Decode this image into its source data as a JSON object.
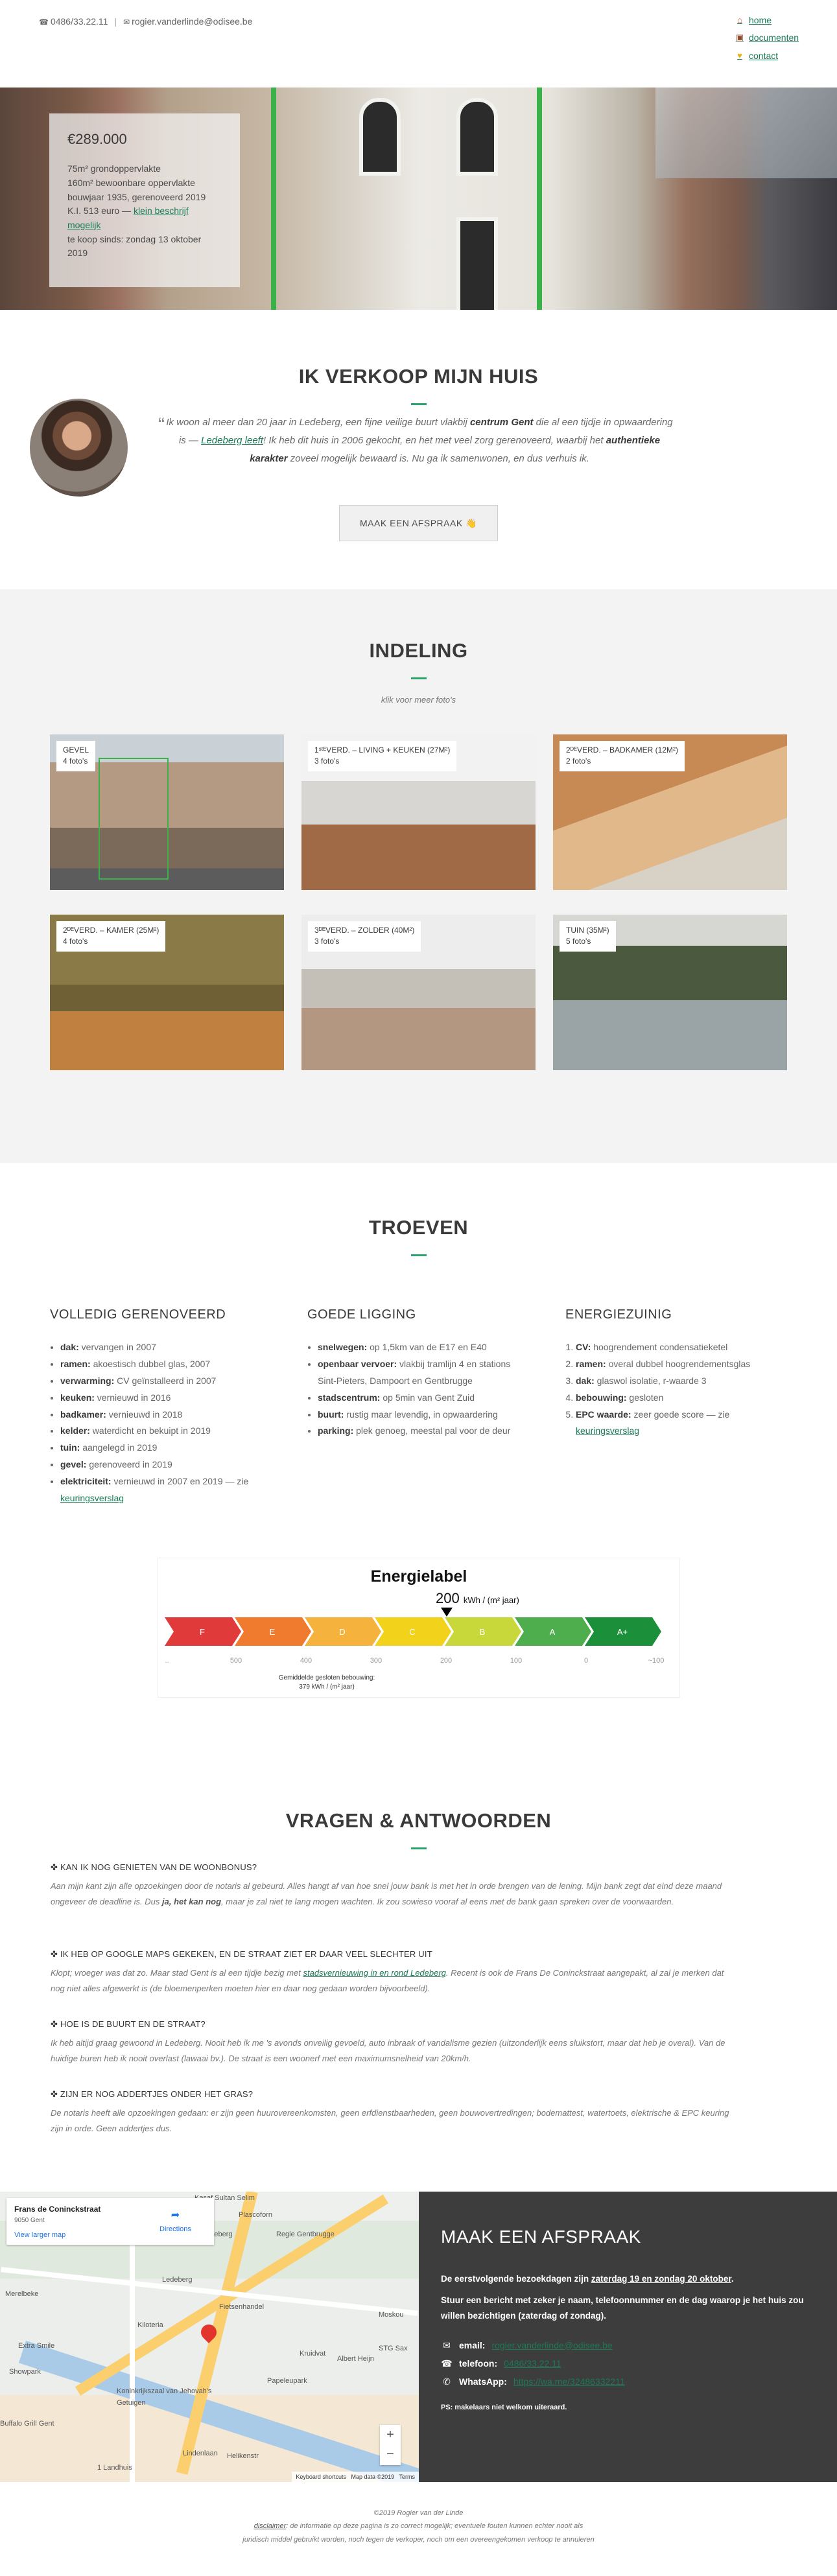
{
  "header": {
    "phone": "0486/33.22.11",
    "email": "rogier.vanderlinde@odisee.be",
    "nav": [
      {
        "label": "home",
        "icon": "home-icon"
      },
      {
        "label": "documenten",
        "icon": "briefcase-icon"
      },
      {
        "label": "contact",
        "icon": "heart-icon"
      }
    ]
  },
  "hero": {
    "price": "€289.000",
    "lines": [
      "75m² grondoppervlakte",
      "160m² bewoonbare oppervlakte",
      "bouwjaar 1935, gerenoveerd 2019",
      "K.I. 513 euro —",
      "te koop sinds: zondag 13 oktober 2019"
    ],
    "ki_link": "klein beschrijf mogelijk"
  },
  "intro": {
    "title": "IK VERKOOP MIJN HUIS",
    "quote_a": "Ik woon al meer dan 20 jaar in Ledeberg, een fijne veilige buurt vlakbij ",
    "quote_b": "centrum Gent",
    "quote_c": " die al een tijdje in opwaardering is — ",
    "quote_link": "Ledeberg leeft",
    "quote_d": "! Ik heb dit huis in 2006 gekocht, en het met veel zorg gerenoveerd, waarbij het ",
    "quote_e": "authentieke karakter",
    "quote_f": " zoveel mogelijk bewaard is. Nu ga ik samenwonen, en dus verhuis ik.",
    "button": "MAAK EEN AFSPRAAK 👋"
  },
  "indeling": {
    "title": "INDELING",
    "hint": "klik voor meer foto's",
    "tiles": [
      {
        "name": "GEVEL",
        "photos": "4 foto's"
      },
      {
        "name": "1ˢᵗᴱVERD. – LIVING + KEUKEN (27M²)",
        "photos": "3 foto's"
      },
      {
        "name": "2ᴰᴱVERD. – BADKAMER (12M²)",
        "photos": "2 foto's"
      },
      {
        "name": "2ᴰᴱVERD. – KAMER (25M²)",
        "photos": "4 foto's"
      },
      {
        "name": "3ᴰᴱVERD. – ZOLDER (40M²)",
        "photos": "3 foto's"
      },
      {
        "name": "TUIN (35M²)",
        "photos": "5 foto's"
      }
    ]
  },
  "troeven": {
    "title": "TROEVEN",
    "col1": {
      "heading": "VOLLEDIG GERENOVEERD",
      "items": [
        {
          "k": "dak:",
          "v": " vervangen in 2007"
        },
        {
          "k": "ramen:",
          "v": " akoestisch dubbel glas, 2007"
        },
        {
          "k": "verwarming:",
          "v": " CV geïnstalleerd in 2007"
        },
        {
          "k": "keuken:",
          "v": " vernieuwd in 2016"
        },
        {
          "k": "badkamer:",
          "v": " vernieuwd in 2018"
        },
        {
          "k": "kelder:",
          "v": " waterdicht en bekuipt in 2019"
        },
        {
          "k": "tuin:",
          "v": " aangelegd in 2019"
        },
        {
          "k": "gevel:",
          "v": " gerenoveerd in 2019"
        },
        {
          "k": "elektriciteit:",
          "v": " vernieuwd in 2007 en 2019 — zie "
        }
      ],
      "link": "keuringsverslag"
    },
    "col2": {
      "heading": "GOEDE LIGGING",
      "items": [
        {
          "k": "snelwegen:",
          "v": " op 1,5km van de E17 en E40"
        },
        {
          "k": "openbaar vervoer:",
          "v": " vlakbij tramlijn 4 en stations Sint-Pieters, Dampoort en Gentbrugge"
        },
        {
          "k": "stadscentrum:",
          "v": " op 5min van Gent Zuid"
        },
        {
          "k": "buurt:",
          "v": " rustig maar levendig, in opwaardering"
        },
        {
          "k": "parking:",
          "v": " plek genoeg, meestal pal voor de deur"
        }
      ]
    },
    "col3": {
      "heading": "ENERGIEZUINIG",
      "items": [
        {
          "k": "CV:",
          "v": " hoogrendement condensatieketel"
        },
        {
          "k": "ramen:",
          "v": " overal dubbel hoogrendementsglas"
        },
        {
          "k": "dak:",
          "v": " glaswol isolatie, r-waarde 3"
        },
        {
          "k": "bebouwing:",
          "v": " gesloten"
        },
        {
          "k": "EPC waarde:",
          "v": " zeer goede score — zie "
        }
      ],
      "link": "keuringsverslag"
    },
    "energy": {
      "title": "Energielabel",
      "value": "200",
      "unit": "kWh / (m² jaar)",
      "labels": [
        "F",
        "E",
        "D",
        "C",
        "B",
        "A",
        "A+"
      ],
      "colors": [
        "#e03a3a",
        "#f07a2e",
        "#f5b23c",
        "#f2d21a",
        "#c8d83a",
        "#4eae4e",
        "#1c8f3a"
      ],
      "ticks": [
        "...",
        "500",
        "400",
        "300",
        "200",
        "100",
        "0",
        "~100"
      ],
      "note1": "Gemiddelde gesloten bebouwing:",
      "note2": "379 kWh / (m² jaar)"
    }
  },
  "faq": {
    "title": "VRAGEN & ANTWOORDEN",
    "items": [
      {
        "q": "✤ KAN IK NOG GENIETEN VAN DE WOONBONUS?",
        "a1": "Aan mijn kant zijn alle opzoekingen door de notaris al gebeurd. Alles hangt af van hoe snel jouw bank is met het in orde brengen van de lening. Mijn bank zegt dat eind deze maand ongeveer de deadline is. Dus ",
        "b": "ja, het kan nog",
        "a2": ", maar je zal niet te lang mogen wachten. Ik zou sowieso vooraf al eens met de bank gaan spreken over de voorwaarden."
      },
      {
        "q": "✤ IK HEB OP GOOGLE MAPS GEKEKEN, EN DE STRAAT ZIET ER DAAR VEEL SLECHTER UIT",
        "a1": "Klopt; vroeger was dat zo. Maar stad Gent is al een tijdje bezig met ",
        "link": "stadsvernieuwing in en rond Ledeberg",
        "a2": ". Recent is ook de Frans De Coninckstraat aangepakt, al zal je merken dat nog niet alles afgewerkt is (de bloemenperken moeten hier en daar nog gedaan worden bijvoorbeeld)."
      },
      {
        "q": "✤ HOE IS DE BUURT EN DE STRAAT?",
        "a1": "Ik heb altijd graag gewoond in Ledeberg. Nooit heb ik me 's avonds onveilig gevoeld, auto inbraak of vandalisme gezien (uitzonderlijk eens sluikstort, maar dat heb je overal). Van de huidige buren heb ik nooit overlast (lawaai bv.). De straat is een woonerf met een maximumsnelheid van 20km/h."
      },
      {
        "q": "✤ ZIJN ER NOG ADDERTJES ONDER HET GRAS?",
        "a1": "De notaris heeft alle opzoekingen gedaan: er zijn geen huurovereenkomsten, geen erfdienstbaarheden, geen bouwovertredingen; bodemattest, watertoets, elektrische & EPC keuring zijn in orde. Geen addertjes dus."
      }
    ]
  },
  "map": {
    "place": "Frans de Coninckstraat",
    "postcode": "9050 Gent",
    "larger": "View larger map",
    "directions": "Directions",
    "labels": [
      "Kasaf Sultan Selim",
      "Plascoforn",
      "Ledeberg",
      "Regie Gentbrugge",
      "Ledeberg",
      "Merelbeke",
      "Fietsenhandel",
      "Kiloteria",
      "Extra Smile",
      "Showpark",
      "Koninkrijkszaal van Jehovah's Getuigen",
      "Kruidvat",
      "Moskou",
      "Albert Heijn",
      "Papeleupark",
      "Buffalo Grill Gent",
      "STG Sax",
      "Lindenlaan",
      "Helikenstr",
      "1 Landhuis",
      "Keyboard shortcuts",
      "Map data ©2019",
      "Terms"
    ]
  },
  "contact": {
    "title": "MAAK EEN AFSPRAAK",
    "p1a": "De eerstvolgende bezoekdagen zijn ",
    "p1link": "zaterdag 19 en zondag 20 oktober",
    "p1b": ".",
    "p2": "Stuur een bericht met zeker je naam, telefoonnummer en de dag waarop je het huis zou willen bezichtigen (zaterdag of zondag).",
    "rows": [
      {
        "icon": "envelope-icon",
        "label": "email:",
        "value": "rogier.vanderlinde@odisee.be"
      },
      {
        "icon": "phone-icon",
        "label": "telefoon:",
        "value": "0486/33.22.11"
      },
      {
        "icon": "whatsapp-icon",
        "label": "WhatsApp:",
        "value": "https://wa.me/32486332211"
      }
    ],
    "ps": "PS: makelaars niet welkom uiteraard."
  },
  "footer": {
    "copyright": "©2019 Rogier van der Linde",
    "disclaimer_link": "disclaimer",
    "disclaimer_1": ": de informatie op deze pagina is zo correct mogelijk; eventuele fouten kunnen echter nooit als",
    "disclaimer_2": "juridisch middel gebruikt worden, noch tegen de verkoper, noch om een overeengekomen verkoop te annuleren"
  }
}
